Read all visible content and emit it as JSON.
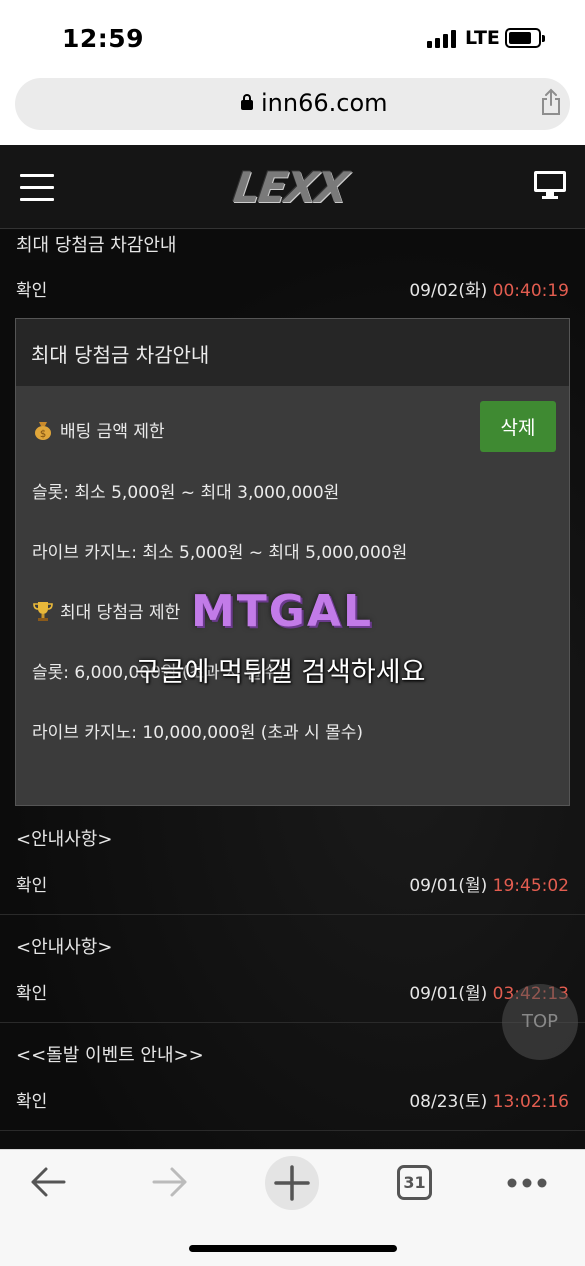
{
  "status": {
    "time": "12:59",
    "network": "LTE"
  },
  "browser": {
    "url": "inn66.com",
    "tabs_count": "31"
  },
  "site": {
    "logo": "LEXX"
  },
  "messages": [
    {
      "title": "최대 당첨금 차감안내",
      "status": "확인",
      "date": "09/02(화)",
      "time": "00:40:19"
    },
    {
      "title": "<안내사항>",
      "status": "확인",
      "date": "09/01(월)",
      "time": "19:45:02"
    },
    {
      "title": "<안내사항>",
      "status": "확인",
      "date": "09/01(월)",
      "time": "03:42:13"
    },
    {
      "title": "<<돌발 이벤트 안내>>",
      "status": "확인",
      "date": "08/23(토)",
      "time": "13:02:16"
    }
  ],
  "panel": {
    "title": "최대 당첨금 차감안내",
    "delete_label": "삭제",
    "lines": [
      "배팅 금액 제한",
      "슬롯: 최소 5,000원 ~ 최대 3,000,000원",
      "라이브 카지노: 최소 5,000원 ~ 최대 5,000,000원",
      "최대 당첨금 제한",
      "슬롯: 6,000,000원 (초과 시 몰수)",
      "라이브 카지노: 10,000,000원 (초과 시 몰수)"
    ]
  },
  "watermark": {
    "logo": "MTGAL",
    "text": "구글에 먹튀갤 검색하세요"
  },
  "top_button": "TOP",
  "icons": {
    "money_bag": "money-bag-icon",
    "trophy": "trophy-icon"
  },
  "colors": {
    "accent_time": "#e35d50",
    "delete_button": "#3f8a32"
  }
}
